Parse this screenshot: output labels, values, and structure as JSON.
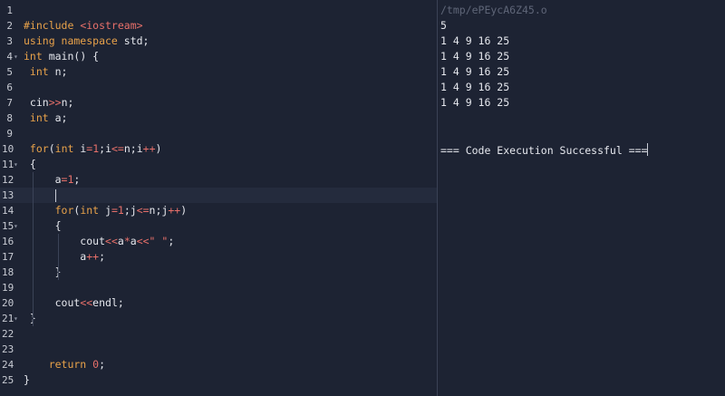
{
  "editor": {
    "lines": [
      {
        "num": "1",
        "fold": false,
        "tokens": []
      },
      {
        "num": "2",
        "fold": false,
        "tokens": [
          {
            "t": "#include ",
            "c": "pre"
          },
          {
            "t": "<iostream>",
            "c": "str"
          }
        ]
      },
      {
        "num": "3",
        "fold": false,
        "tokens": [
          {
            "t": "using namespace ",
            "c": "kw"
          },
          {
            "t": "std;",
            "c": "txt"
          }
        ]
      },
      {
        "num": "4",
        "fold": true,
        "tokens": [
          {
            "t": "int ",
            "c": "kw"
          },
          {
            "t": "main() {",
            "c": "txt"
          }
        ]
      },
      {
        "num": "5",
        "fold": false,
        "tokens": [
          {
            "t": " int ",
            "c": "kw"
          },
          {
            "t": "n;",
            "c": "txt"
          }
        ]
      },
      {
        "num": "6",
        "fold": false,
        "tokens": []
      },
      {
        "num": "7",
        "fold": false,
        "tokens": [
          {
            "t": " cin",
            "c": "txt"
          },
          {
            "t": ">>",
            "c": "op"
          },
          {
            "t": "n;",
            "c": "txt"
          }
        ]
      },
      {
        "num": "8",
        "fold": false,
        "tokens": [
          {
            "t": " int ",
            "c": "kw"
          },
          {
            "t": "a;",
            "c": "txt"
          }
        ]
      },
      {
        "num": "9",
        "fold": false,
        "tokens": []
      },
      {
        "num": "10",
        "fold": false,
        "tokens": [
          {
            "t": " for",
            "c": "kw"
          },
          {
            "t": "(",
            "c": "txt"
          },
          {
            "t": "int ",
            "c": "kw"
          },
          {
            "t": "i",
            "c": "txt"
          },
          {
            "t": "=1",
            "c": "op"
          },
          {
            "t": ";i",
            "c": "txt"
          },
          {
            "t": "<=",
            "c": "op"
          },
          {
            "t": "n;i",
            "c": "txt"
          },
          {
            "t": "++",
            "c": "op"
          },
          {
            "t": ")",
            "c": "txt"
          }
        ]
      },
      {
        "num": "11",
        "fold": true,
        "tokens": [
          {
            "t": " {",
            "c": "txt"
          }
        ]
      },
      {
        "num": "12",
        "fold": false,
        "tokens": [
          {
            "t": "     a",
            "c": "txt"
          },
          {
            "t": "=1",
            "c": "op"
          },
          {
            "t": ";",
            "c": "txt"
          }
        ]
      },
      {
        "num": "13",
        "fold": false,
        "tokens": []
      },
      {
        "num": "14",
        "fold": false,
        "tokens": [
          {
            "t": "     for",
            "c": "kw"
          },
          {
            "t": "(",
            "c": "txt"
          },
          {
            "t": "int ",
            "c": "kw"
          },
          {
            "t": "j",
            "c": "txt"
          },
          {
            "t": "=1",
            "c": "op"
          },
          {
            "t": ";j",
            "c": "txt"
          },
          {
            "t": "<=",
            "c": "op"
          },
          {
            "t": "n;j",
            "c": "txt"
          },
          {
            "t": "++",
            "c": "op"
          },
          {
            "t": ")",
            "c": "txt"
          }
        ]
      },
      {
        "num": "15",
        "fold": true,
        "tokens": [
          {
            "t": "     {",
            "c": "txt"
          }
        ]
      },
      {
        "num": "16",
        "fold": false,
        "tokens": [
          {
            "t": "         cout",
            "c": "txt"
          },
          {
            "t": "<<",
            "c": "op"
          },
          {
            "t": "a",
            "c": "txt"
          },
          {
            "t": "*",
            "c": "op"
          },
          {
            "t": "a",
            "c": "txt"
          },
          {
            "t": "<<",
            "c": "op"
          },
          {
            "t": "\" \"",
            "c": "str"
          },
          {
            "t": ";",
            "c": "txt"
          }
        ]
      },
      {
        "num": "17",
        "fold": false,
        "tokens": [
          {
            "t": "         a",
            "c": "txt"
          },
          {
            "t": "++",
            "c": "op"
          },
          {
            "t": ";",
            "c": "txt"
          }
        ]
      },
      {
        "num": "18",
        "fold": false,
        "tokens": [
          {
            "t": "     }",
            "c": "txt"
          }
        ]
      },
      {
        "num": "19",
        "fold": false,
        "tokens": []
      },
      {
        "num": "20",
        "fold": false,
        "tokens": [
          {
            "t": "     cout",
            "c": "txt"
          },
          {
            "t": "<<",
            "c": "op"
          },
          {
            "t": "endl;",
            "c": "txt"
          }
        ]
      },
      {
        "num": "21",
        "fold": true,
        "tokens": [
          {
            "t": " }",
            "c": "txt"
          }
        ]
      },
      {
        "num": "22",
        "fold": false,
        "tokens": []
      },
      {
        "num": "23",
        "fold": false,
        "tokens": []
      },
      {
        "num": "24",
        "fold": false,
        "tokens": [
          {
            "t": "    return ",
            "c": "kw"
          },
          {
            "t": "0",
            "c": "num"
          },
          {
            "t": ";",
            "c": "txt"
          }
        ]
      },
      {
        "num": "25",
        "fold": false,
        "tokens": [
          {
            "t": "}",
            "c": "txt"
          }
        ]
      }
    ]
  },
  "output": {
    "path": "/tmp/ePEycA6Z45.o",
    "lines": [
      "5",
      "1 4 9 16 25",
      "1 4 9 16 25",
      "1 4 9 16 25",
      "1 4 9 16 25",
      "1 4 9 16 25",
      "",
      "",
      "=== Code Execution Successful ==="
    ]
  },
  "colors": {
    "background": "#1d2333",
    "keyword": "#e8a24a",
    "string": "#e8706a",
    "text": "#e6e8ee"
  },
  "icons": {
    "fold_marker": "chevron-down-icon"
  }
}
